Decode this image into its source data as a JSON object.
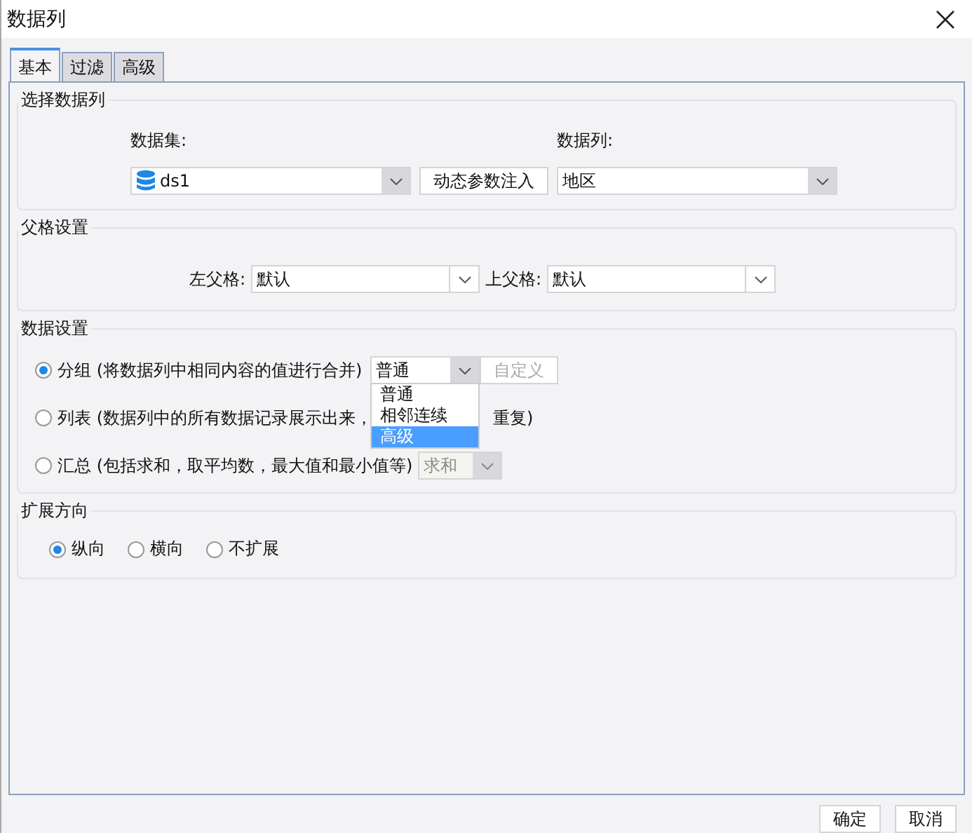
{
  "window": {
    "title": "数据列"
  },
  "tabs": [
    {
      "label": "基本",
      "selected": true
    },
    {
      "label": "过滤",
      "selected": false
    },
    {
      "label": "高级",
      "selected": false
    }
  ],
  "select_column": {
    "title": "选择数据列",
    "dataset_label": "数据集:",
    "dataset_value": "ds1",
    "dynamic_button": "动态参数注入",
    "column_label": "数据列:",
    "column_value": "地区"
  },
  "parent_cell": {
    "title": "父格设置",
    "left_label": "左父格:",
    "left_value": "默认",
    "top_label": "上父格:",
    "top_value": "默认"
  },
  "data_settings": {
    "title": "数据设置",
    "options": [
      {
        "kind": "group",
        "label": "分组",
        "note": "(将数据列中相同内容的值进行合并)",
        "selected": true,
        "combo": "普通",
        "button": "自定义",
        "button_disabled": true
      },
      {
        "kind": "list",
        "label": "列表",
        "note": "(数据列中的所有数据记录展示出来，",
        "note_end": "重复)",
        "selected": false
      },
      {
        "kind": "summary",
        "label": "汇总",
        "note": "(包括求和，取平均数，最大值和最小值等)",
        "selected": false,
        "combo": "求和",
        "combo_disabled": true
      }
    ],
    "dropdown": [
      {
        "label": "普通",
        "selected": false
      },
      {
        "label": "相邻连续",
        "selected": false
      },
      {
        "label": "高级",
        "selected": true
      }
    ]
  },
  "expand": {
    "title": "扩展方向",
    "options": [
      {
        "label": "纵向",
        "selected": true
      },
      {
        "label": "横向",
        "selected": false
      },
      {
        "label": "不扩展",
        "selected": false
      }
    ]
  },
  "buttons": [
    "确定",
    "取消"
  ]
}
